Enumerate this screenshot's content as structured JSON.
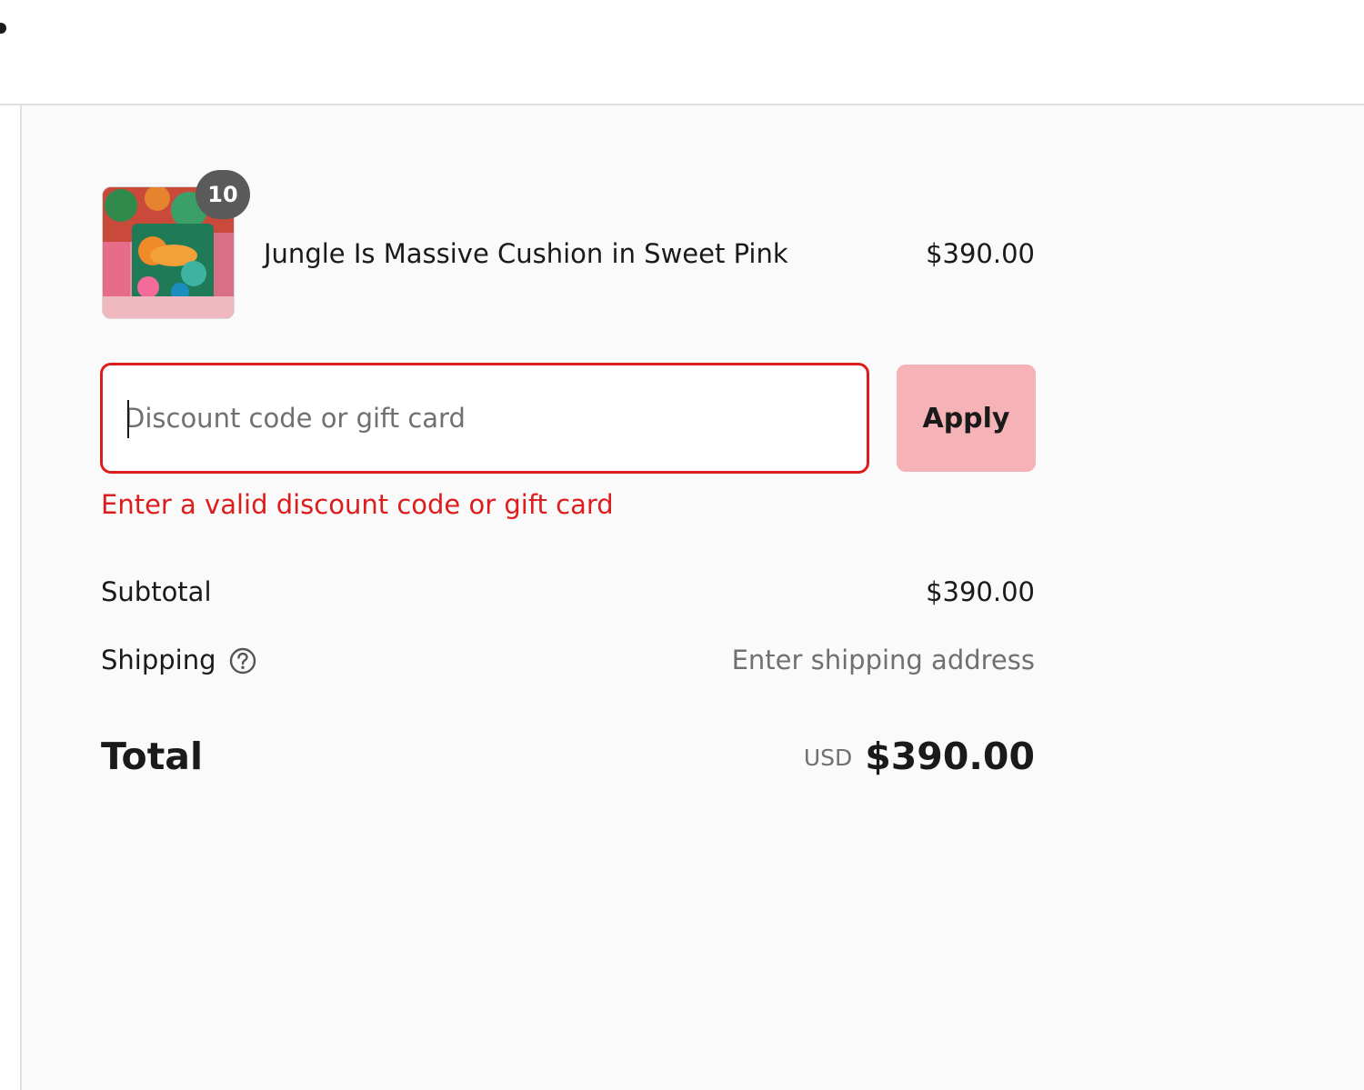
{
  "line_item": {
    "quantity": "10",
    "name": "Jungle Is Massive Cushion in Sweet Pink",
    "price": "$390.00"
  },
  "discount": {
    "placeholder": "Discount code or gift card",
    "value": "",
    "apply_label": "Apply",
    "error": "Enter a valid discount code or gift card"
  },
  "costs": {
    "subtotal_label": "Subtotal",
    "subtotal_value": "$390.00",
    "shipping_label": "Shipping",
    "shipping_value": "Enter shipping address",
    "total_label": "Total",
    "currency": "USD",
    "total_value": "$390.00"
  },
  "colors": {
    "error": "#dd1d1d",
    "apply_button": "#f6b3b7",
    "summary_background": "#fafafa"
  },
  "icons": {
    "shipping_help": "question-circle-icon"
  }
}
